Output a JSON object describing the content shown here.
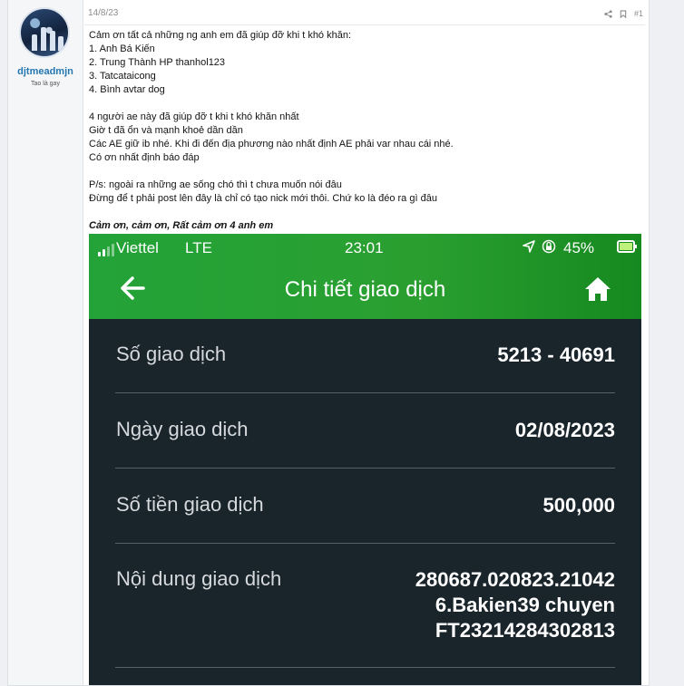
{
  "author": {
    "name": "djtmeadmjn",
    "title": "Tao là gay"
  },
  "post": {
    "date": "14/8/23",
    "number": "#1",
    "lines": [
      "Cảm ơn tất cả những ng anh em đã giúp đỡ khi t khó khăn:",
      "1. Anh Bá Kiến",
      "2. Trung Thành HP thanhol123",
      "3. Tatcataicong",
      "4. Bình avtar dog",
      "",
      "4 người ae này đã giúp đỡ t khi t khó khăn nhất",
      "Giờ t đã ổn và mạnh khoẻ dần dần",
      "Các AE giữ ib nhé. Khi đi đến địa phương nào nhất định AE phải var nhau cái nhé.",
      "Có ơn nhất định báo đáp",
      "",
      "P/s: ngoài ra những ae sống chó thì t chưa muốn nói đâu",
      "Đừng để t phải post lên đây là chỉ có tạo nick mới thôi. Chứ ko là đéo ra gì đâu",
      ""
    ],
    "signature": "Cảm ơn, cảm ơn, Rất cảm ơn 4 anh em"
  },
  "screenshot": {
    "status": {
      "carrier": "Viettel",
      "network": "LTE",
      "time": "23:01",
      "battery": "45%"
    },
    "nav_title": "Chi tiết giao dịch",
    "rows": [
      {
        "label": "Số giao dịch",
        "value": [
          "5213 - 40691"
        ]
      },
      {
        "label": "Ngày giao dịch",
        "value": [
          "02/08/2023"
        ]
      },
      {
        "label": "Số tiền giao dịch",
        "value": [
          "500,000"
        ]
      },
      {
        "label": "Nội dung giao dịch",
        "value": [
          "280687.020823.21042",
          "6.Bakien39 chuyen",
          "FT23214284302813"
        ]
      }
    ]
  },
  "colors": {
    "link": "#2577b1",
    "app_green": "#23a338",
    "app_dark": "#1a242b"
  }
}
